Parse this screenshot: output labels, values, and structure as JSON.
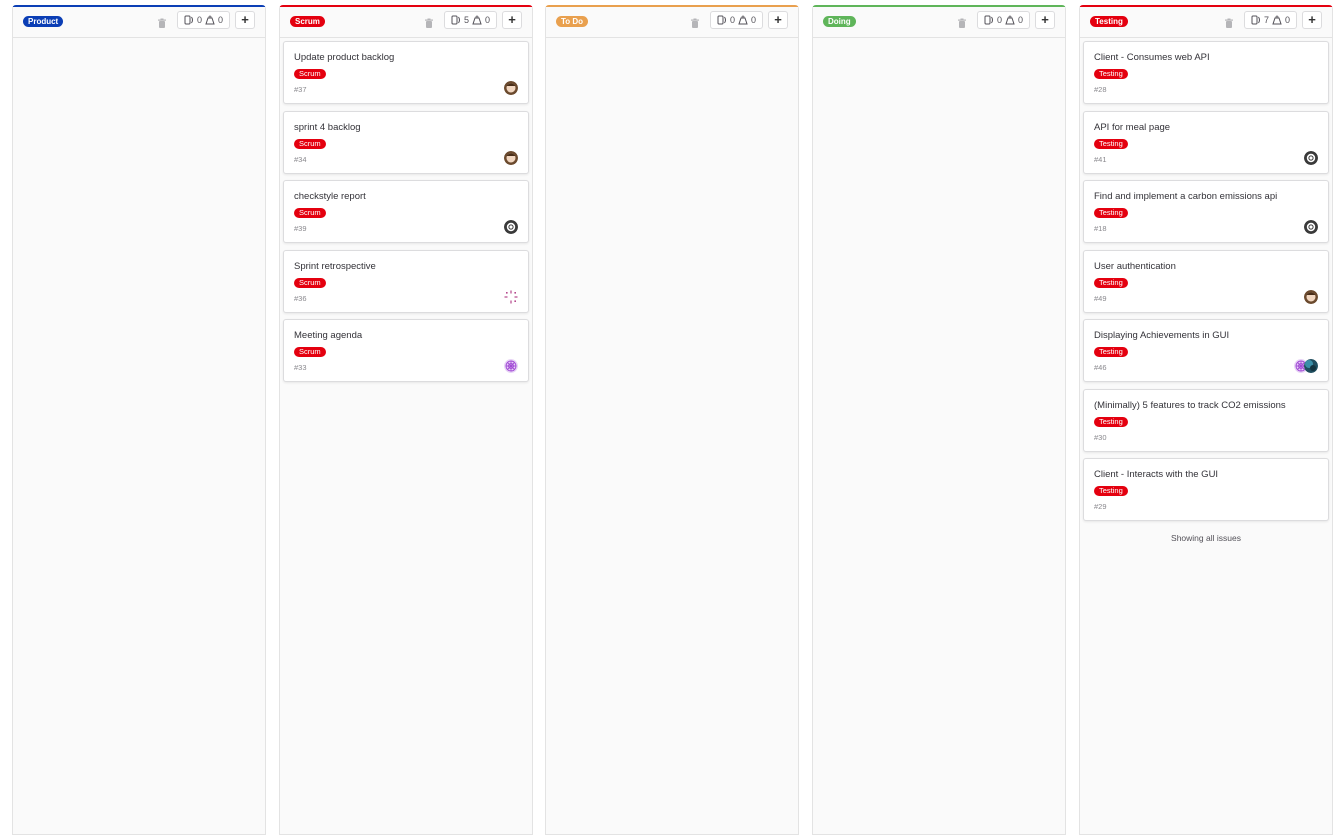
{
  "colors": {
    "product": "#0b3eb5",
    "scrum": "#e4000f",
    "todo": "#e9a04e",
    "doing": "#5fb55a",
    "testing": "#e4000f"
  },
  "columns": [
    {
      "label": "Product",
      "issue_count": "0",
      "weight": "0",
      "cards": []
    },
    {
      "label": "Scrum",
      "issue_count": "5",
      "weight": "0",
      "cards": [
        {
          "title": "Update product backlog",
          "label": "Scrum",
          "number": "#37",
          "avatars": [
            "photo-avatar"
          ]
        },
        {
          "title": "sprint 4 backlog",
          "label": "Scrum",
          "number": "#34",
          "avatars": [
            "photo-avatar"
          ]
        },
        {
          "title": "checkstyle report",
          "label": "Scrum",
          "number": "#39",
          "avatars": [
            "ring-avatar"
          ]
        },
        {
          "title": "Sprint retrospective",
          "label": "Scrum",
          "number": "#36",
          "avatars": [
            "spinner-avatar"
          ]
        },
        {
          "title": "Meeting agenda",
          "label": "Scrum",
          "number": "#33",
          "avatars": [
            "pattern-avatar"
          ]
        }
      ]
    },
    {
      "label": "To Do",
      "issue_count": "0",
      "weight": "0",
      "cards": []
    },
    {
      "label": "Doing",
      "issue_count": "0",
      "weight": "0",
      "cards": []
    },
    {
      "label": "Testing",
      "issue_count": "7",
      "weight": "0",
      "cards": [
        {
          "title": "Client - Consumes web API",
          "label": "Testing",
          "number": "#28",
          "avatars": []
        },
        {
          "title": "API for meal page",
          "label": "Testing",
          "number": "#41",
          "avatars": [
            "ring-avatar"
          ]
        },
        {
          "title": "Find and implement a carbon emissions api",
          "label": "Testing",
          "number": "#18",
          "avatars": [
            "ring-avatar"
          ]
        },
        {
          "title": "User authentication",
          "label": "Testing",
          "number": "#49",
          "avatars": [
            "photo-avatar"
          ]
        },
        {
          "title": "Displaying Achievements in GUI",
          "label": "Testing",
          "number": "#46",
          "avatars": [
            "pattern-avatar",
            "globe-avatar"
          ]
        },
        {
          "title": "(Minimally) 5 features to track CO2 emissions",
          "label": "Testing",
          "number": "#30",
          "avatars": []
        },
        {
          "title": "Client - Interacts with the GUI",
          "label": "Testing",
          "number": "#29",
          "avatars": []
        }
      ],
      "footer": "Showing all issues"
    }
  ]
}
